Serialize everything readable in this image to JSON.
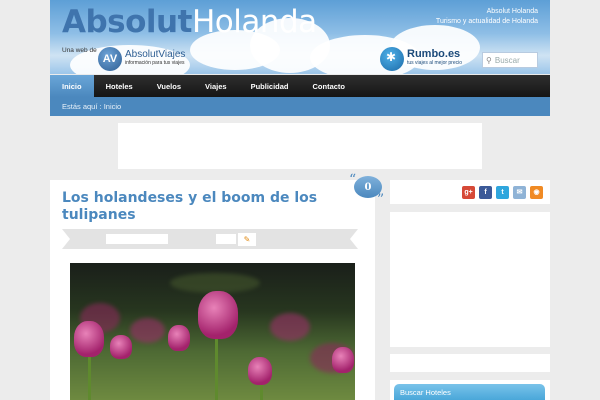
{
  "header": {
    "title_part1": "Absolut",
    "title_part2": "Holanda",
    "site_name": "Absolut Holanda",
    "tagline": "Turismo y actualidad de Holanda",
    "web_de": "Una web de",
    "av_mark": "AV",
    "av_name": "AbsolutViajes",
    "av_sub": "información para tus viajes",
    "rumbo_name": "Rumbo.es",
    "rumbo_sub": "tus viajes al mejor precio",
    "search_placeholder": "Buscar"
  },
  "nav": {
    "items": [
      {
        "label": "Inicio"
      },
      {
        "label": "Hoteles"
      },
      {
        "label": "Vuelos"
      },
      {
        "label": "Viajes"
      },
      {
        "label": "Publicidad"
      },
      {
        "label": "Contacto"
      }
    ]
  },
  "breadcrumb": {
    "text": "Estás aquí : Inicio"
  },
  "post": {
    "title": "Los holandeses y el boom de los tulipanes",
    "comment_count": "0",
    "quote_open": "“",
    "quote_close": "”"
  },
  "sidebar": {
    "social": [
      {
        "label": "g+",
        "icon": "google-plus-icon",
        "color": "#d64937"
      },
      {
        "label": "f",
        "icon": "facebook-icon",
        "color": "#3b5998"
      },
      {
        "label": "t",
        "icon": "twitter-icon",
        "color": "#2fa6dd"
      },
      {
        "label": "✉",
        "icon": "mail-icon",
        "color": "#8fb3d6"
      },
      {
        "label": "◉",
        "icon": "rss-icon",
        "color": "#f08a24"
      }
    ],
    "tab_label": "Buscar Hoteles"
  },
  "colors": {
    "accent_blue": "#4b88be",
    "nav_dark": "#1e1e1e",
    "page_bg": "#ececec"
  }
}
